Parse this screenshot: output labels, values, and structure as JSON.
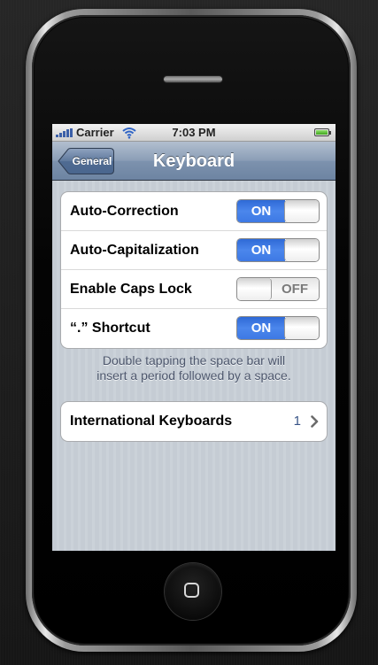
{
  "status_bar": {
    "carrier": "Carrier",
    "time": "7:03 PM",
    "signal_icon": "signal-bars-icon",
    "wifi_icon": "wifi-icon",
    "battery_icon": "battery-icon",
    "battery_level": 1.0
  },
  "nav": {
    "back_label": "General",
    "title": "Keyboard"
  },
  "settings": [
    {
      "label": "Auto-Correction",
      "on": true
    },
    {
      "label": "Auto-Capitalization",
      "on": true
    },
    {
      "label": "Enable Caps Lock",
      "on": false
    },
    {
      "label": "“.” Shortcut",
      "on": true
    }
  ],
  "switch_labels": {
    "on": "ON",
    "off": "OFF"
  },
  "footnote": {
    "line1": "Double tapping the space bar will",
    "line2": "insert a period followed by a space."
  },
  "international": {
    "label": "International Keyboards",
    "value": "1",
    "chevron_icon": "chevron-right-icon"
  },
  "colors": {
    "switch_on": "#3d79e4",
    "nav_bar": "#6d84a2",
    "background": "#c5ccd4"
  }
}
